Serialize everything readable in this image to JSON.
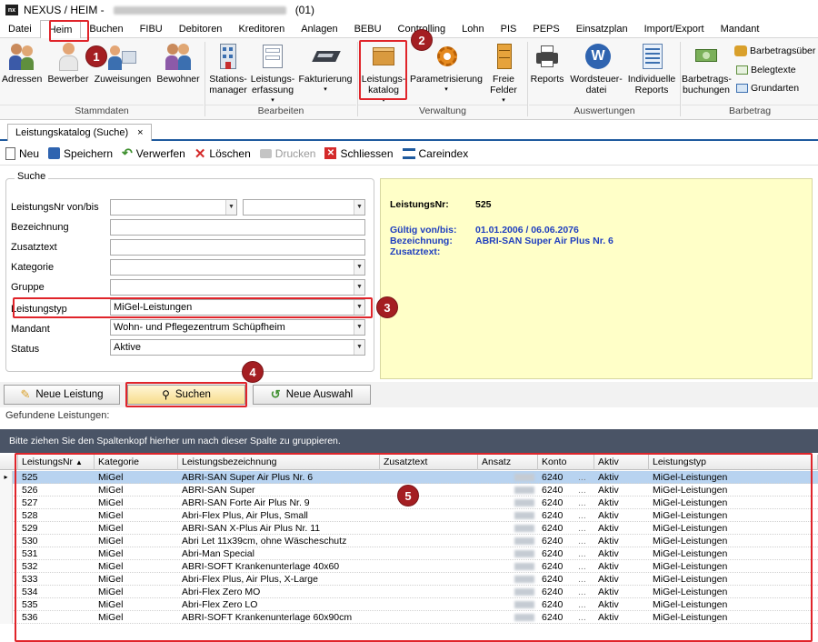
{
  "window": {
    "app_title": "NEXUS / HEIM -",
    "title_suffix": "(01)",
    "app_icon": "nx"
  },
  "menu": [
    {
      "label": "Datei"
    },
    {
      "label": "Heim"
    },
    {
      "label": "Buchen"
    },
    {
      "label": "FIBU"
    },
    {
      "label": "Debitoren"
    },
    {
      "label": "Kreditoren"
    },
    {
      "label": "Anlagen"
    },
    {
      "label": "BEBU"
    },
    {
      "label": "Controlling"
    },
    {
      "label": "Lohn"
    },
    {
      "label": "PIS"
    },
    {
      "label": "PEPS"
    },
    {
      "label": "Einsatzplan"
    },
    {
      "label": "Import/Export"
    },
    {
      "label": "Mandant"
    }
  ],
  "ribbon": {
    "buttons": {
      "adressen": "Adressen",
      "bewerber": "Bewerber",
      "zuweisungen": "Zuweisungen",
      "bewohner": "Bewohner",
      "stations_1": "Stations-",
      "stations_2": "manager",
      "leistungserf_1": "Leistungs-",
      "leistungserf_2": "erfassung",
      "fakturierung": "Fakturierung",
      "katalog_1": "Leistungs-",
      "katalog_2": "katalog",
      "parametrisierung": "Parametrisierung",
      "freie_1": "Freie",
      "freie_2": "Felder",
      "reports": "Reports",
      "wordsteuer_1": "Wordsteuer-",
      "wordsteuer_2": "datei",
      "individuelle_1": "Individuelle",
      "individuelle_2": "Reports",
      "barbetrags_1": "Barbetrags-",
      "barbetrags_2": "buchungen",
      "barbetragsueber": "Barbetragsüber",
      "belegtexte": "Belegtexte",
      "grundarten": "Grundarten"
    },
    "groups": {
      "stammdaten": "Stammdaten",
      "bearbeiten": "Bearbeiten",
      "verwaltung": "Verwaltung",
      "auswertungen": "Auswertungen",
      "barbetrag": "Barbetrag"
    }
  },
  "tab": {
    "label": "Leistungskatalog (Suche)",
    "close": "×"
  },
  "toolbar": {
    "neu": "Neu",
    "speichern": "Speichern",
    "verwerfen": "Verwerfen",
    "loeschen": "Löschen",
    "drucken": "Drucken",
    "schliessen": "Schliessen",
    "careindex": "Careindex"
  },
  "suche": {
    "legend": "Suche",
    "fields": {
      "leistungsnr": "LeistungsNr von/bis",
      "bezeichnung": "Bezeichnung",
      "zusatztext": "Zusatztext",
      "kategorie": "Kategorie",
      "gruppe": "Gruppe",
      "leistungstyp": "Leistungstyp",
      "mandant": "Mandant",
      "status": "Status"
    },
    "values": {
      "leistungstyp": "MiGel-Leistungen",
      "mandant": "Wohn- und Pflegezentrum Schüpfheim",
      "status": "Aktive"
    }
  },
  "info": {
    "nr_label": "LeistungsNr:",
    "nr_value": "525",
    "gueltig_label": "Gültig von/bis:",
    "gueltig_value": "01.01.2006 / 06.06.2076",
    "bez_label": "Bezeichnung:",
    "bez_value": "ABRI-SAN Super Air Plus Nr. 6",
    "zusatz_label": "Zusatztext:"
  },
  "buttons": {
    "neue_leistung": "Neue Leistung",
    "suchen": "Suchen",
    "neue_auswahl": "Neue Auswahl"
  },
  "results": {
    "label": "Gefundene Leistungen:",
    "group_hint": "Bitte ziehen Sie den Spaltenkopf hierher um nach dieser Spalte zu gruppieren.",
    "columns": [
      "LeistungsNr",
      "Kategorie",
      "Leistungsbezeichnung",
      "Zusatztext",
      "Ansatz",
      "Konto",
      "Aktiv",
      "Leistungstyp"
    ],
    "sort_indicator": "▲",
    "rows": [
      {
        "nr": "525",
        "kat": "MiGel",
        "bez": "ABRI-SAN Super Air Plus Nr. 6",
        "konto": "6240",
        "aktiv": "Aktiv",
        "typ": "MiGel-Leistungen"
      },
      {
        "nr": "526",
        "kat": "MiGel",
        "bez": "ABRI-SAN Super",
        "konto": "6240",
        "aktiv": "Aktiv",
        "typ": "MiGel-Leistungen"
      },
      {
        "nr": "527",
        "kat": "MiGel",
        "bez": "ABRI-SAN Forte Air Plus Nr. 9",
        "konto": "6240",
        "aktiv": "Aktiv",
        "typ": "MiGel-Leistungen"
      },
      {
        "nr": "528",
        "kat": "MiGel",
        "bez": "Abri-Flex Plus, Air Plus, Small",
        "konto": "6240",
        "aktiv": "Aktiv",
        "typ": "MiGel-Leistungen"
      },
      {
        "nr": "529",
        "kat": "MiGel",
        "bez": "ABRI-SAN X-Plus Air Plus Nr. 11",
        "konto": "6240",
        "aktiv": "Aktiv",
        "typ": "MiGel-Leistungen"
      },
      {
        "nr": "530",
        "kat": "MiGel",
        "bez": "Abri Let 11x39cm, ohne Wäscheschutz",
        "konto": "6240",
        "aktiv": "Aktiv",
        "typ": "MiGel-Leistungen"
      },
      {
        "nr": "531",
        "kat": "MiGel",
        "bez": "Abri-Man Special",
        "konto": "6240",
        "aktiv": "Aktiv",
        "typ": "MiGel-Leistungen"
      },
      {
        "nr": "532",
        "kat": "MiGel",
        "bez": "ABRI-SOFT Krankenunterlage 40x60",
        "konto": "6240",
        "aktiv": "Aktiv",
        "typ": "MiGel-Leistungen"
      },
      {
        "nr": "533",
        "kat": "MiGel",
        "bez": "Abri-Flex Plus, Air Plus, X-Large",
        "konto": "6240",
        "aktiv": "Aktiv",
        "typ": "MiGel-Leistungen"
      },
      {
        "nr": "534",
        "kat": "MiGel",
        "bez": "Abri-Flex Zero MO",
        "konto": "6240",
        "aktiv": "Aktiv",
        "typ": "MiGel-Leistungen"
      },
      {
        "nr": "535",
        "kat": "MiGel",
        "bez": "Abri-Flex Zero LO",
        "konto": "6240",
        "aktiv": "Aktiv",
        "typ": "MiGel-Leistungen"
      },
      {
        "nr": "536",
        "kat": "MiGel",
        "bez": "ABRI-SOFT Krankenunterlage 60x90cm",
        "konto": "6240",
        "aktiv": "Aktiv",
        "typ": "MiGel-Leistungen"
      }
    ]
  },
  "callouts": [
    "1",
    "2",
    "3",
    "4",
    "5"
  ],
  "colors": {
    "highlight": "#e0242a",
    "badge": "#a41e22",
    "info_bg": "#ffffc8",
    "selected_row": "#b8d3f0"
  }
}
